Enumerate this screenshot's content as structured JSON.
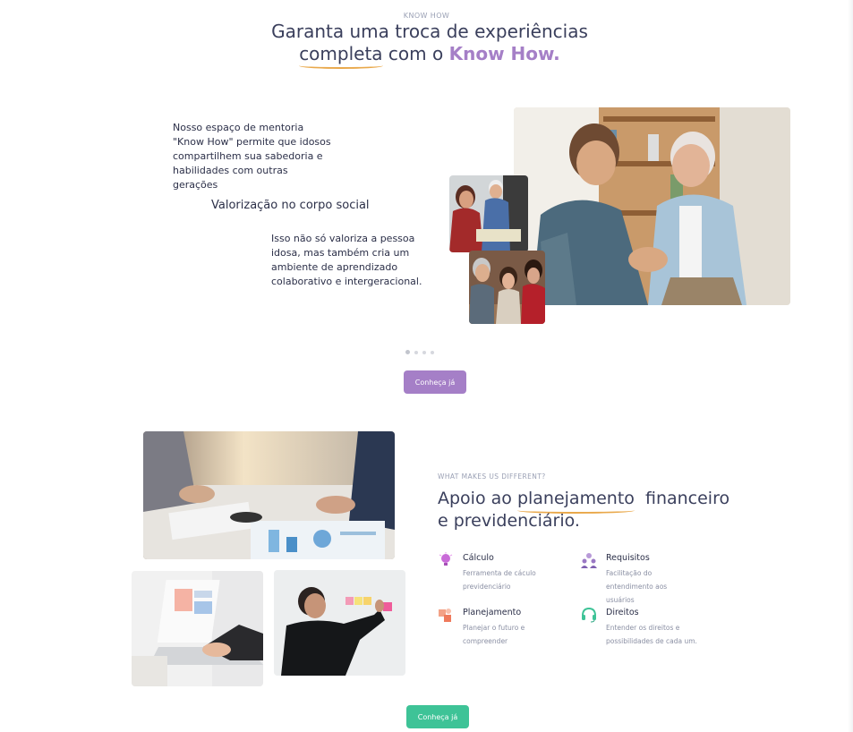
{
  "section1": {
    "eyebrow": "KNOW HOW",
    "title_line1": "Garanta uma troca de experiências",
    "title_underlined": "completa",
    "title_mid": " com o ",
    "title_accent": "Know How.",
    "paragraph1": "Nosso espaço de mentoria \"Know How\" permite que idosos compartilhem sua sabedoria e habilidades com outras gerações",
    "subheading": "Valorização no corpo social",
    "paragraph2": "Isso não só valoriza a pessoa idosa, mas também cria um ambiente de aprendizado colaborativo e intergeracional.",
    "slider_dots": 4,
    "active_dot": 0,
    "cta_label": "Conheça já",
    "cta_color": "#a57fc7"
  },
  "section2": {
    "eyebrow": "WHAT MAKES US DIFFERENT?",
    "title_pre": "Apoio ao ",
    "title_underlined": "planejamento",
    "title_post": "  financeiro",
    "title_line2": "e previdenciário.",
    "features": [
      {
        "icon": "lightbulb-icon",
        "color": "#c96bd8",
        "title": "Cálculo",
        "desc": "Ferramenta de cáculo previdenciário"
      },
      {
        "icon": "users-icon",
        "color": "#9a78c4",
        "title": "Requisitos",
        "desc": "Facilitação do entendimento aos usuários"
      },
      {
        "icon": "puzzle-icon",
        "color": "#ef8a6f",
        "title": "Planejamento",
        "desc": "Planejar o futuro e compreender"
      },
      {
        "icon": "headset-icon",
        "color": "#3ec397",
        "title": "Direitos",
        "desc": "Entender os direitos e possibilidades de cada um."
      }
    ],
    "cta_label": "Conheça já",
    "cta_color": "#3ec397"
  }
}
